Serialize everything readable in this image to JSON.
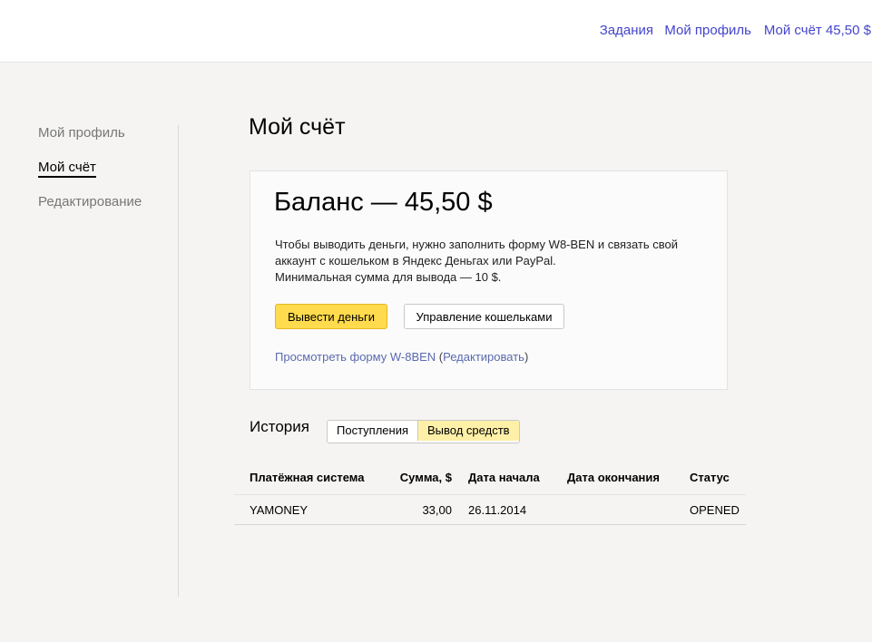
{
  "header": {
    "nav": [
      {
        "label": "Задания"
      },
      {
        "label": "Мой профиль"
      },
      {
        "label": "Мой счёт 45,50 $"
      }
    ]
  },
  "sidebar": {
    "items": [
      {
        "label": "Мой профиль",
        "active": false
      },
      {
        "label": "Мой счёт",
        "active": true
      },
      {
        "label": "Редактирование",
        "active": false
      }
    ]
  },
  "main": {
    "title": "Мой счёт",
    "balance_card": {
      "balance": "Баланс — 45,50 $",
      "info_lines": [
        "Чтобы выводить деньги, нужно заполнить форму W8-BEN и связать свой",
        "аккаунт с кошельком в Яндекс Деньгах или PayPal.",
        "Минимальная сумма для вывода — 10 $."
      ],
      "withdraw_button": "Вывести деньги",
      "wallets_button": "Управление кошельками",
      "view_form_link": "Просмотреть форму W-8BEN",
      "paren_open": " (",
      "edit_link": "Редактировать",
      "paren_close": ")"
    },
    "history": {
      "title": "История",
      "tabs": [
        {
          "label": "Поступления",
          "active": false
        },
        {
          "label": "Вывод средств",
          "active": true
        }
      ],
      "columns": [
        "Платёжная система",
        "Сумма, $",
        "Дата начала",
        "Дата окончания",
        "Статус"
      ],
      "rows": [
        {
          "system": "YAMONEY",
          "amount": "33,00",
          "start": "26.11.2014",
          "end": "",
          "status": "OPENED"
        }
      ]
    }
  },
  "colors": {
    "link": "#4444cc",
    "primary_button": "#ffdb4d",
    "active_tab": "#fff0a8",
    "background": "#f5f4f2"
  }
}
